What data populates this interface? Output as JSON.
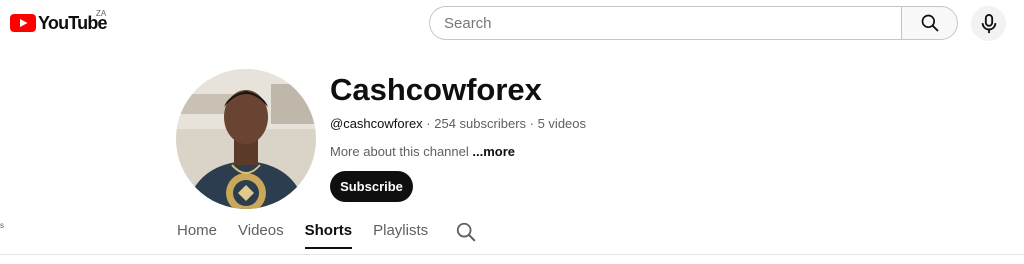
{
  "header": {
    "logo_text": "YouTube",
    "region": "ZA",
    "search_placeholder": "Search"
  },
  "channel": {
    "name": "Cashcowforex",
    "handle": "@cashcowforex",
    "subscribers": "254 subscribers",
    "videos": "5 videos",
    "separator": " · ",
    "about": "More about this channel",
    "about_more": "...more",
    "subscribe_label": "Subscribe"
  },
  "tabs": [
    {
      "label": "Home",
      "active": false
    },
    {
      "label": "Videos",
      "active": false
    },
    {
      "label": "Shorts",
      "active": true
    },
    {
      "label": "Playlists",
      "active": false
    }
  ],
  "edge_text": "s",
  "colors": {
    "brand_red": "#ff0000",
    "text_primary": "#0f0f0f",
    "text_secondary": "#606060"
  },
  "icons": [
    "youtube-logo-icon",
    "search-icon",
    "microphone-icon",
    "tab-search-icon"
  ]
}
